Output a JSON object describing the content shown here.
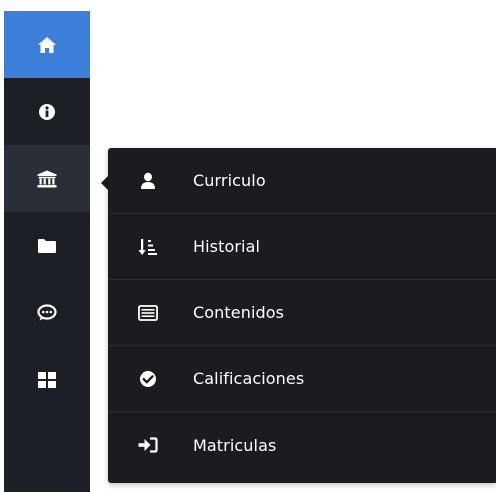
{
  "sidebar": {
    "items": [
      {
        "icon": "home-icon",
        "state": "highlighted"
      },
      {
        "icon": "info-icon"
      },
      {
        "icon": "institution-icon",
        "state": "active"
      },
      {
        "icon": "folder-icon"
      },
      {
        "icon": "comment-icon"
      },
      {
        "icon": "grid-icon"
      }
    ]
  },
  "flyout": {
    "items": [
      {
        "label": "Curriculo",
        "icon": "user-icon"
      },
      {
        "label": "Historial",
        "icon": "sort-list-icon"
      },
      {
        "label": "Contenidos",
        "icon": "list-card-icon"
      },
      {
        "label": "Calificaciones",
        "icon": "check-circle-icon"
      },
      {
        "label": "Matriculas",
        "icon": "sign-in-icon"
      }
    ]
  },
  "colors": {
    "sidebar_bg": "#1c1f25",
    "home_highlight": "#3c7fd9",
    "active_bg": "#2a2e36",
    "flyout_bg": "#1b1c20",
    "text": "#ffffff"
  }
}
